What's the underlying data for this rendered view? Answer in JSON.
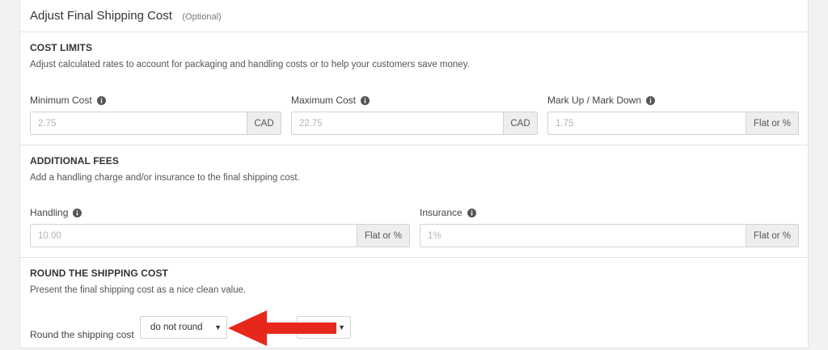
{
  "header": {
    "title": "Adjust Final Shipping Cost",
    "optional": "(Optional)"
  },
  "cost_limits": {
    "title": "COST LIMITS",
    "description": "Adjust calculated rates to account for packaging and handling costs or to help your customers save money.",
    "minimum": {
      "label": "Minimum Cost",
      "placeholder": "2.75",
      "addon": "CAD"
    },
    "maximum": {
      "label": "Maximum Cost",
      "placeholder": "22.75",
      "addon": "CAD"
    },
    "markup": {
      "label": "Mark Up / Mark Down",
      "placeholder": "1.75",
      "addon": "Flat or %"
    }
  },
  "additional_fees": {
    "title": "ADDITIONAL FEES",
    "description": "Add a handling charge and/or insurance to the final shipping cost.",
    "handling": {
      "label": "Handling",
      "placeholder": "10.00",
      "addon": "Flat or %"
    },
    "insurance": {
      "label": "Insurance",
      "placeholder": "1%",
      "addon": "Flat or %"
    }
  },
  "rounding": {
    "title": "ROUND THE SHIPPING COST",
    "description": "Present the final shipping cost as a nice clean value.",
    "label": "Round the shipping cost",
    "mode_value": "do not round",
    "secondary_value": ""
  },
  "colors": {
    "arrow": "#e8271c",
    "info_icon": "#555555"
  }
}
